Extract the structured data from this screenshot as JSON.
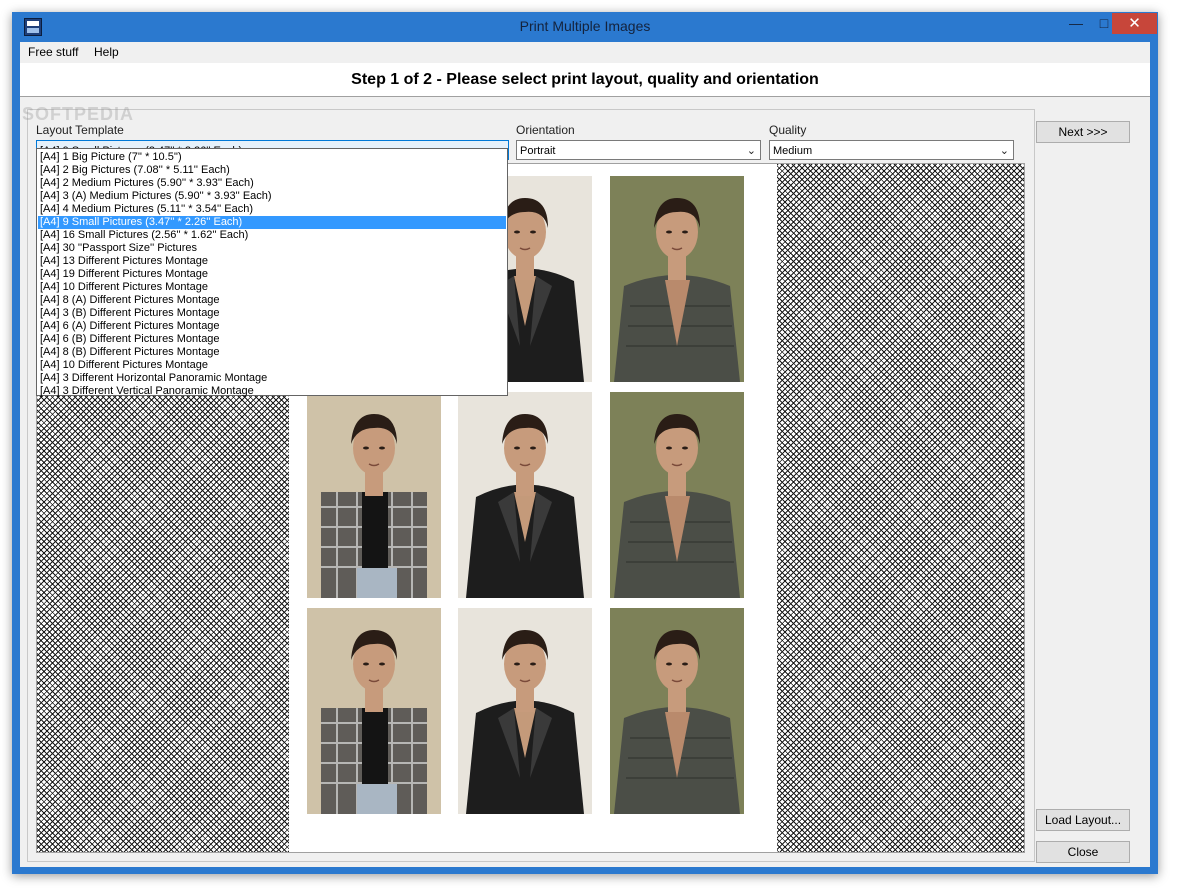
{
  "window": {
    "title": "Print Multiple Images",
    "minimize": "—",
    "maximize": "□",
    "close": "✕"
  },
  "menu": [
    "Free stuff",
    "Help"
  ],
  "header": {
    "title": "Step 1 of 2 - Please select print layout, quality and orientation"
  },
  "watermark": "SOFTPEDIA",
  "layout": {
    "label": "Layout Template",
    "selected": "[A4] 9 Small Pictures (3.47'' * 2.26'' Each)",
    "options": [
      "[A4] 1 Big Picture (7'' * 10.5'')",
      "[A4] 2 Big Pictures (7.08'' * 5.11'' Each)",
      "[A4] 2 Medium Pictures (5.90'' * 3.93'' Each)",
      "[A4] 3 (A) Medium Pictures (5.90'' * 3.93'' Each)",
      "[A4] 4 Medium Pictures (5.11'' * 3.54'' Each)",
      "[A4] 9 Small Pictures (3.47'' * 2.26'' Each)",
      "[A4] 16 Small Pictures (2.56'' * 1.62'' Each)",
      "[A4] 30 ''Passport Size'' Pictures",
      "[A4] 13 Different Pictures Montage",
      "[A4] 19 Different Pictures Montage",
      "[A4] 10 Different Pictures Montage",
      "[A4] 8 (A) Different Pictures Montage",
      "[A4] 3 (B) Different Pictures Montage",
      "[A4] 6 (A) Different Pictures Montage",
      "[A4] 6 (B) Different Pictures Montage",
      "[A4] 8 (B) Different Pictures Montage",
      "[A4] 10 Different Pictures Montage",
      "[A4] 3 Different Horizontal Panoramic Montage",
      "[A4] 3 Different Vertical Panoramic Montage"
    ],
    "selected_index": 5
  },
  "orientation": {
    "label": "Orientation",
    "value": "Portrait"
  },
  "quality": {
    "label": "Quality",
    "value": "Medium"
  },
  "buttons": {
    "next": "Next >>>",
    "load": "Load Layout...",
    "close": "Close"
  },
  "colors": {
    "titlebar": "#2b79cf",
    "close_button": "#c7463a",
    "selection": "#3399ff"
  },
  "photos": [
    {
      "subject": "plaid-shirt",
      "bg": "#cfc2a8",
      "jacket": "#5f5c58",
      "shirt": "#141414"
    },
    {
      "subject": "leather-jacket",
      "bg": "#e8e4dc",
      "jacket": "#1d1d1d",
      "shirt": "#c49a7a"
    },
    {
      "subject": "grey-jacket",
      "bg": "#7d8158",
      "jacket": "#4b4e47",
      "shirt": "#b98a6c"
    },
    {
      "subject": "plaid-shirt",
      "bg": "#cfc2a8",
      "jacket": "#5f5c58",
      "shirt": "#141414"
    },
    {
      "subject": "leather-jacket",
      "bg": "#e8e4dc",
      "jacket": "#1d1d1d",
      "shirt": "#c49a7a"
    },
    {
      "subject": "grey-jacket",
      "bg": "#7d8158",
      "jacket": "#4b4e47",
      "shirt": "#b98a6c"
    },
    {
      "subject": "plaid-shirt",
      "bg": "#cfc2a8",
      "jacket": "#5f5c58",
      "shirt": "#141414"
    },
    {
      "subject": "leather-jacket",
      "bg": "#e8e4dc",
      "jacket": "#1d1d1d",
      "shirt": "#c49a7a"
    },
    {
      "subject": "grey-jacket",
      "bg": "#7d8158",
      "jacket": "#4b4e47",
      "shirt": "#b98a6c"
    }
  ]
}
